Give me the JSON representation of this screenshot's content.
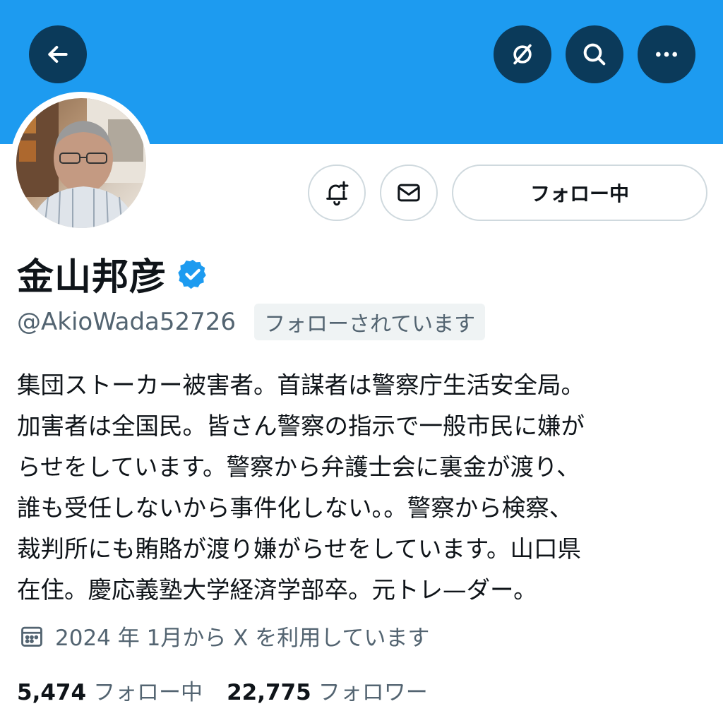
{
  "colors": {
    "banner": "#1d9bf0",
    "header_button_bg": "#0b3a5a",
    "verified": "#1d9bf0",
    "secondary_text": "#536471",
    "primary_text": "#0f1419",
    "border": "#cfd9de"
  },
  "header": {
    "icons": [
      "back-arrow-icon",
      "grok-icon",
      "search-icon",
      "more-icon"
    ]
  },
  "profile": {
    "name": "金山邦彦",
    "verified": true,
    "handle": "@AkioWada52726",
    "follows_you": "フォローされています",
    "bio": "集団ストーカー被害者。首謀者は警察庁生活安全局。\n加害者は全国民。皆さん警察の指示で一般市民に嫌が\nらせをしています。警察から弁護士会に裏金が渡り、\n誰も受任しないから事件化しない。。警察から検察、\n裁判所にも賄賂が渡り嫌がらせをしています。山口県\n在住。慶応義塾大学経済学部卒。元トレ—ダー。",
    "joined": "2024 年 1月から X を利用しています"
  },
  "actions": {
    "notify_icon": "bell-plus-icon",
    "message_icon": "mail-icon",
    "follow_label": "フォロー中"
  },
  "stats": {
    "following_count": "5,474",
    "following_label": "フォロー中",
    "followers_count": "22,775",
    "followers_label": "フォロワー"
  }
}
